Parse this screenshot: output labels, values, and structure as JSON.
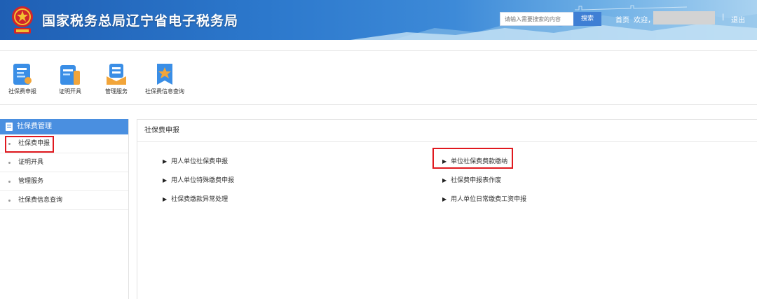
{
  "header": {
    "title": "国家税务总局辽宁省电子税务局",
    "emblem_icon": "national-emblem-icon",
    "search": {
      "placeholder": "请输入需要搜索的内容",
      "button": "搜索"
    },
    "nav": {
      "home": "首页",
      "welcome": "欢迎，",
      "separator": "|",
      "logout": "退出"
    },
    "colors": {
      "bar_start": "#1f5fb4",
      "bar_end": "#a9d2f0"
    }
  },
  "toolbar": {
    "items": [
      {
        "label": "社保费申报",
        "icon": "declaration-icon"
      },
      {
        "label": "证明开具",
        "icon": "certificate-icon"
      },
      {
        "label": "管理服务",
        "icon": "management-icon"
      },
      {
        "label": "社保费信息查询",
        "icon": "info-query-icon"
      }
    ]
  },
  "sidebar": {
    "header": "社保费管理",
    "items": [
      {
        "label": "社保费申报"
      },
      {
        "label": "证明开具"
      },
      {
        "label": "管理服务"
      },
      {
        "label": "社保费信息查询"
      }
    ],
    "accent": "#4a8fe0"
  },
  "main": {
    "title": "社保费申报",
    "links": [
      {
        "label": "用人单位社保费申报"
      },
      {
        "label": "用人单位特殊缴费申报"
      },
      {
        "label": "社保费缴款异常处理"
      },
      {
        "label": "单位社保费费款缴纳"
      },
      {
        "label": "社保费申报表作废"
      },
      {
        "label": "用人单位日常缴费工资申报"
      }
    ]
  },
  "highlight_color": "#e0191f"
}
